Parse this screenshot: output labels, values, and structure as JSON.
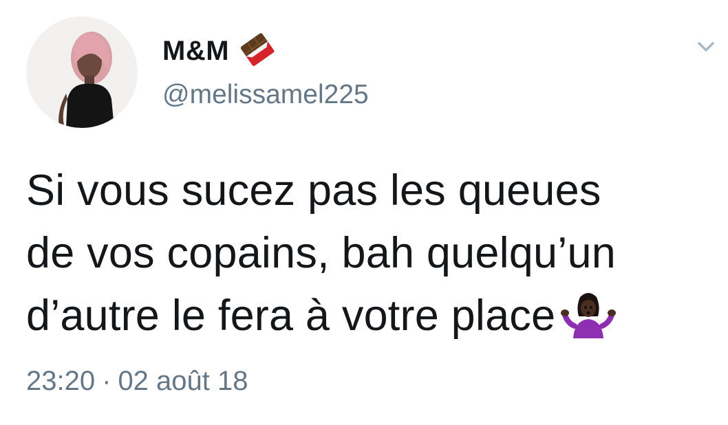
{
  "author": {
    "display_name": "M&M",
    "name_emoji": "chocolate-bar-icon",
    "handle": "@melissamel225"
  },
  "tweet": {
    "lines": [
      "Si vous sucez pas les queues",
      "de vos copains, bah quelqu’un",
      "d’autre le fera à votre place"
    ],
    "trailing_emoji": "woman-shrugging-icon"
  },
  "meta": {
    "time": "23:20",
    "separator": "·",
    "date": "02 août 18"
  },
  "colors": {
    "text_primary": "#14171a",
    "text_secondary": "#657786",
    "chevron": "#aab8c2",
    "background": "#ffffff"
  }
}
